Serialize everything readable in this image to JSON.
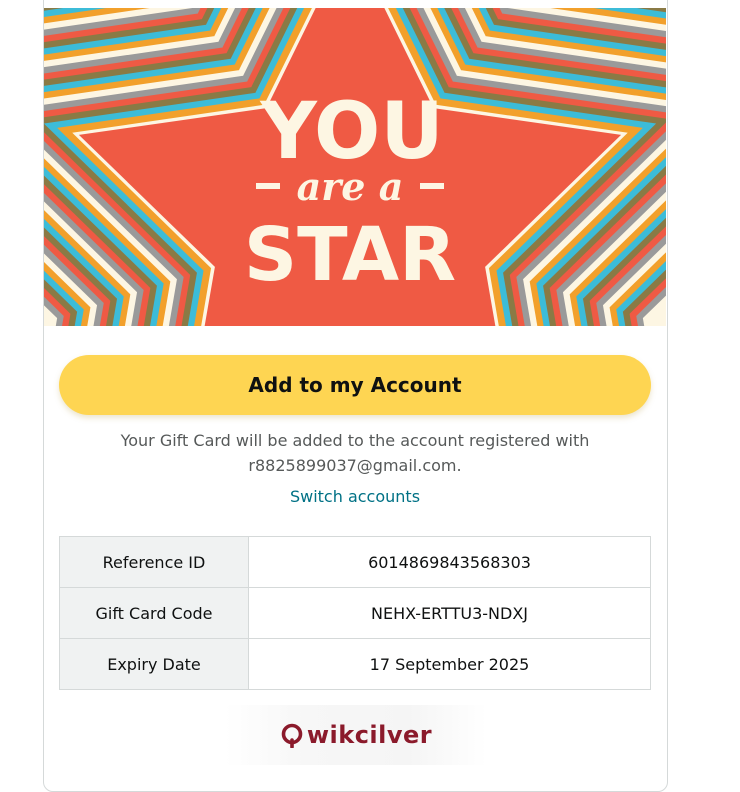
{
  "banner": {
    "line1": "YOU",
    "line2": "are a",
    "line3": "STAR"
  },
  "actions": {
    "add_button_label": "Add to my Account",
    "note_line1": "Your Gift Card will be added to the account registered with",
    "note_line2": "r8825899037@gmail.com.",
    "switch_accounts_label": "Switch accounts"
  },
  "details": {
    "rows": [
      {
        "label": "Reference ID",
        "value": "6014869843568303"
      },
      {
        "label": "Gift Card Code",
        "value": "NEHX-ERTTU3-NDXJ"
      },
      {
        "label": "Expiry Date",
        "value": "17 September 2025"
      }
    ]
  },
  "logo": {
    "text": "wikcilver",
    "brand_color": "#8b1a2b"
  },
  "colors": {
    "button": "#fed552",
    "link": "#007185",
    "star": "#ef5a44"
  }
}
